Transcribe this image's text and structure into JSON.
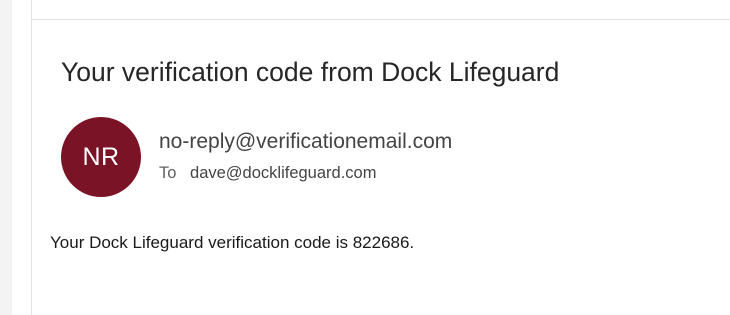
{
  "email": {
    "subject": "Your verification code from Dock Lifeguard",
    "sender": {
      "initials": "NR",
      "address": "no-reply@verificationemail.com",
      "avatar_color": "#7b1326"
    },
    "to": {
      "label": "To",
      "address": "dave@docklifeguard.com"
    },
    "body": "Your Dock Lifeguard verification code is 822686."
  }
}
